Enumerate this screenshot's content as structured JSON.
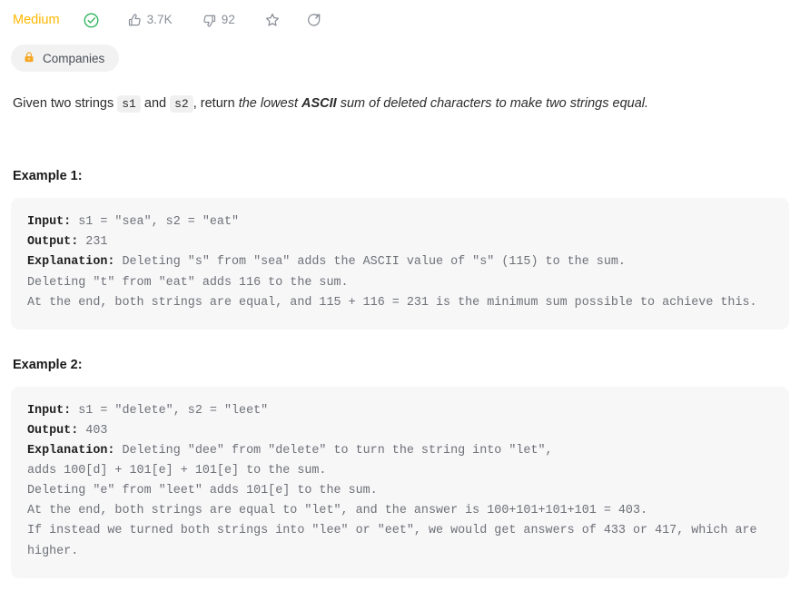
{
  "meta": {
    "difficulty": "Medium",
    "solved_icon": "check-circle-icon",
    "likes_icon": "thumbs-up-icon",
    "likes_count": "3.7K",
    "dislikes_icon": "thumbs-down-icon",
    "dislikes_count": "92",
    "favorite_icon": "star-icon",
    "share_icon": "share-icon",
    "difficulty_color": "#ffb800",
    "solved_color": "#2db55d"
  },
  "tags": {
    "companies": {
      "label": "Companies",
      "icon": "lock-icon",
      "icon_color": "#f5a623"
    }
  },
  "statement": {
    "lead": "Given two strings ",
    "code_1": "s1",
    "mid": " and ",
    "code_2": "s2",
    "after_code": ", return ",
    "italic_start": "the lowest ",
    "italic_bold": "ASCII",
    "italic_end": " sum of deleted characters to make two strings equal."
  },
  "examples": [
    {
      "title": "Example 1:",
      "input_label": "Input:",
      "input_value": " s1 = \"sea\", s2 = \"eat\"",
      "output_label": "Output:",
      "output_value": " 231",
      "explanation_label": "Explanation:",
      "explanation_value": " Deleting \"s\" from \"sea\" adds the ASCII value of \"s\" (115) to the sum.\nDeleting \"t\" from \"eat\" adds 116 to the sum.\nAt the end, both strings are equal, and 115 + 116 = 231 is the minimum sum possible to achieve this."
    },
    {
      "title": "Example 2:",
      "input_label": "Input:",
      "input_value": " s1 = \"delete\", s2 = \"leet\"",
      "output_label": "Output:",
      "output_value": " 403",
      "explanation_label": "Explanation:",
      "explanation_value": " Deleting \"dee\" from \"delete\" to turn the string into \"let\",\nadds 100[d] + 101[e] + 101[e] to the sum.\nDeleting \"e\" from \"leet\" adds 101[e] to the sum.\nAt the end, both strings are equal to \"let\", and the answer is 100+101+101+101 = 403.\nIf instead we turned both strings into \"lee\" or \"eet\", we would get answers of 433 or 417, which are higher."
    }
  ]
}
